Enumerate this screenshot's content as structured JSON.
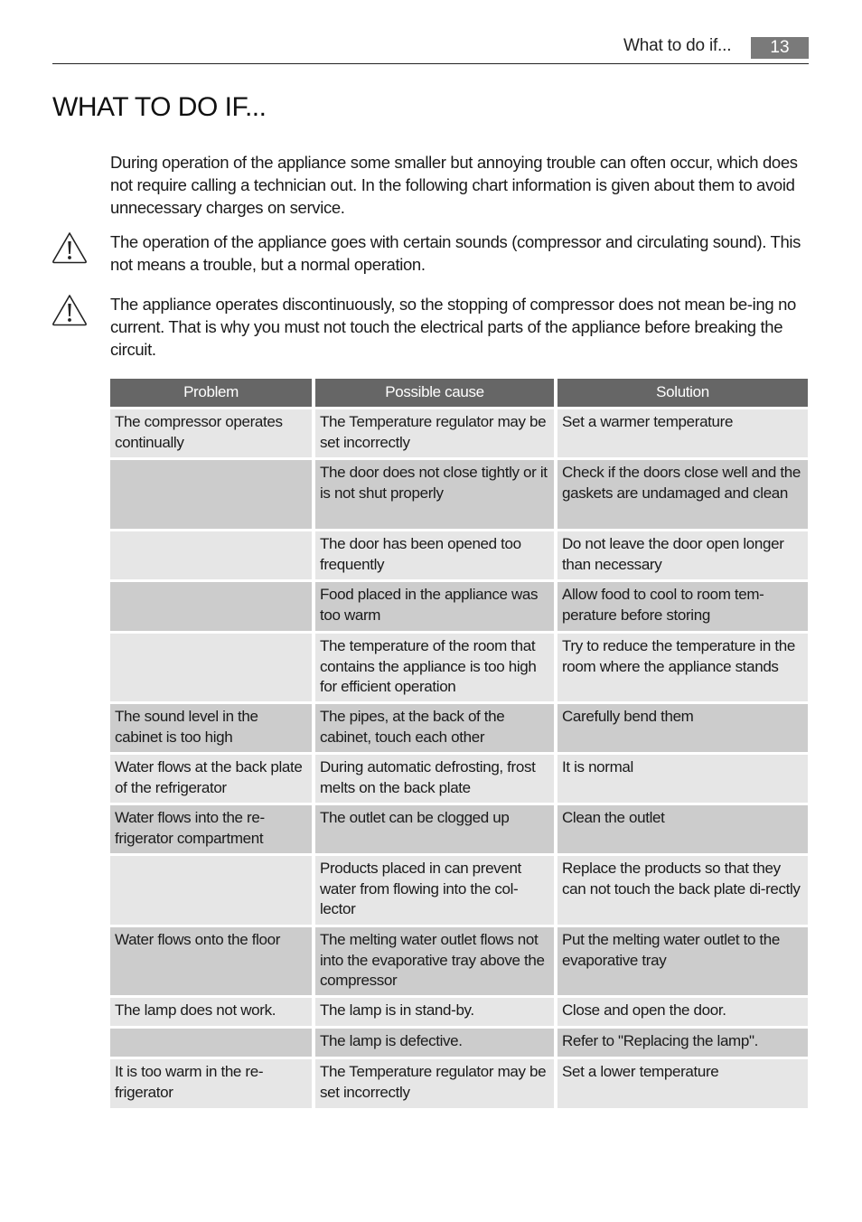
{
  "header": {
    "section": "What to do if...",
    "page_number": "13"
  },
  "title": "WHAT TO DO IF...",
  "intro": "During operation of the appliance some smaller but annoying trouble can often occur, which does not require calling a technician out. In the following chart information is given about them to avoid unnecessary charges on service.",
  "warnings": [
    {
      "icon": "warning-triangle-icon",
      "text": "The operation of the appliance goes with certain sounds (compressor and circulating sound). This not means a trouble, but a normal operation."
    },
    {
      "icon": "warning-triangle-icon",
      "text": "The appliance operates discontinuously, so the stopping of compressor does not mean be-ing no current. That is why you must not touch the electrical parts of the appliance before breaking the circuit."
    }
  ],
  "table": {
    "columns": [
      "Problem",
      "Possible cause",
      "Solution"
    ],
    "rows": [
      {
        "problem": "The compressor operates continually",
        "cause": "The Temperature regulator may be set incorrectly",
        "solution": "Set a warmer temperature"
      },
      {
        "problem": "",
        "cause": "The door does not close tightly or it is not shut properly",
        "solution": "Check if the doors close well and the gaskets are undamaged and clean"
      },
      {
        "problem": "",
        "cause": "The door has been opened too frequently",
        "solution": "Do not leave the door open longer than necessary"
      },
      {
        "problem": "",
        "cause": "Food placed in the appliance was too warm",
        "solution": "Allow food to cool to room tem-perature before storing"
      },
      {
        "problem": "",
        "cause": "The temperature of the room that contains the appliance is too high for efficient operation",
        "solution": "Try to reduce the temperature in the room where the appliance stands"
      },
      {
        "problem": "The sound level in the cabinet is too high",
        "cause": "The pipes, at the back of the cabinet, touch each other",
        "solution": "Carefully bend them"
      },
      {
        "problem": "Water flows at the back plate of the refrigerator",
        "cause": "During automatic defrosting, frost melts on the back plate",
        "solution": "It is normal"
      },
      {
        "problem": "Water flows into the re-frigerator compartment",
        "cause": "The outlet can be clogged up",
        "solution": "Clean the outlet"
      },
      {
        "problem": "",
        "cause": "Products placed in can prevent water from flowing into the col-lector",
        "solution": "Replace the products so that they can not touch the back plate di-rectly"
      },
      {
        "problem": "Water flows onto the floor",
        "cause": "The melting water outlet flows not into the evaporative tray above the compressor",
        "solution": "Put the melting water outlet to the evaporative tray"
      },
      {
        "problem": "The lamp does not work.",
        "cause": "The lamp is in stand-by.",
        "solution": "Close and open the door."
      },
      {
        "problem": "",
        "cause": "The lamp is defective.",
        "solution": "Refer to \"Replacing the lamp\"."
      },
      {
        "problem": "It is too warm in the re-frigerator",
        "cause": "The Temperature regulator may be set incorrectly",
        "solution": "Set a lower temperature"
      }
    ]
  }
}
